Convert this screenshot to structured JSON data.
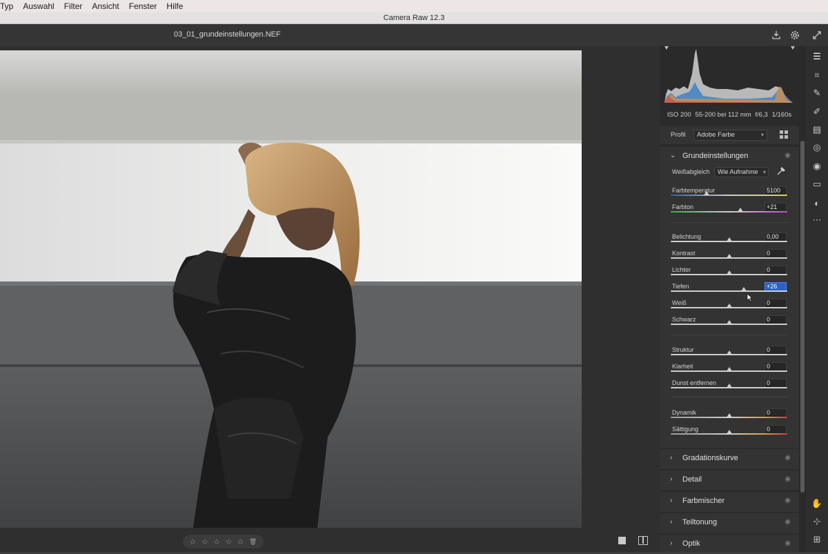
{
  "menubar": {
    "items": [
      "Typ",
      "Auswahl",
      "Filter",
      "Ansicht",
      "Fenster",
      "Hilfe"
    ]
  },
  "window": {
    "title": "Camera Raw 12.3"
  },
  "toolbar": {
    "filename": "03_01_grundeinstellungen.NEF",
    "icons": [
      "save-icon",
      "gear-icon",
      "fullscreen-icon"
    ]
  },
  "exif": {
    "iso": "ISO 200",
    "lens": "55-200 bei 112 mm",
    "aperture": "f/6,3",
    "shutter": "1/160s"
  },
  "profile": {
    "label": "Profil",
    "value": "Adobe Farbe"
  },
  "basic": {
    "title": "Grundeinstellungen",
    "wb_label": "Weißabgleich",
    "wb_value": "Wie Aufnahme",
    "sliders": [
      {
        "label": "Farbtemperatur",
        "value": "5100",
        "pos": 0.31
      },
      {
        "label": "Farbton",
        "value": "+21",
        "pos": 0.6
      },
      {
        "label": "Belichtung",
        "value": "0,00",
        "pos": 0.5
      },
      {
        "label": "Kontrast",
        "value": "0",
        "pos": 0.5
      },
      {
        "label": "Lichter",
        "value": "0",
        "pos": 0.5
      },
      {
        "label": "Tiefen",
        "value": "+26",
        "pos": 0.63
      },
      {
        "label": "Weiß",
        "value": "0",
        "pos": 0.5
      },
      {
        "label": "Schwarz",
        "value": "0",
        "pos": 0.5
      },
      {
        "label": "Struktur",
        "value": "0",
        "pos": 0.5
      },
      {
        "label": "Klarheit",
        "value": "0",
        "pos": 0.5
      },
      {
        "label": "Dunst entfernen",
        "value": "0",
        "pos": 0.5
      },
      {
        "label": "Dynamik",
        "value": "0",
        "pos": 0.5
      },
      {
        "label": "Sättigung",
        "value": "0",
        "pos": 0.5
      }
    ]
  },
  "sections": [
    "Gradationskurve",
    "Detail",
    "Farbmischer",
    "Teiltonung",
    "Optik"
  ],
  "tools": [
    "edit-sliders-icon",
    "crop-icon",
    "healing-icon",
    "brush-icon",
    "gradient-icon",
    "radial-icon",
    "redeye-icon",
    "snapshots-icon",
    "presets-icon",
    "more-icon",
    "hand-icon",
    "sampler-icon",
    "grid-icon"
  ],
  "rating": {
    "stars": [
      "☆",
      "☆",
      "☆",
      "☆",
      "☆"
    ],
    "trash": "🗑"
  },
  "colors": {
    "panel": "#333333",
    "highlight": "#2a62c9",
    "background": "#2f2f2f"
  }
}
